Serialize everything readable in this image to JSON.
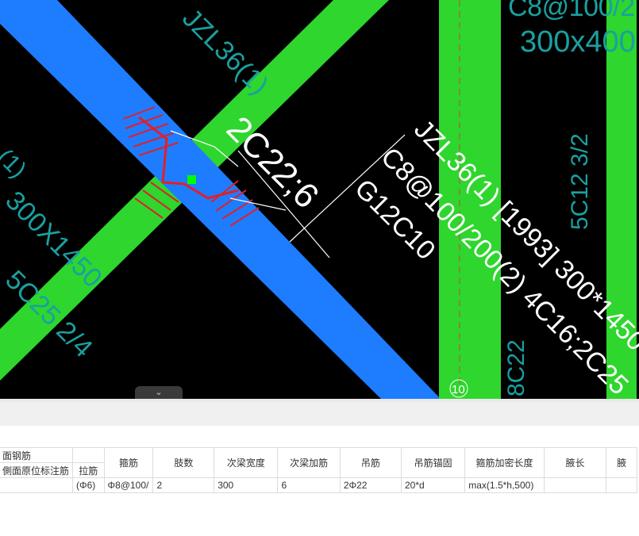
{
  "cad": {
    "upper_right_partial_label": "C8@100/2",
    "upper_right_dim": "300x400",
    "vertical_rebar": "5C12 3/2",
    "diag_beam_label": "JZL36(1)",
    "left_dim": "300X1450",
    "left_code": "5C25 2/4",
    "left_partial": "(1)",
    "hanger_text": "2C22;6",
    "annotation_line1": "JZL36(1) [1993] 300*1450",
    "annotation_line2": "C8@100/200(2) 4C16;2C25",
    "annotation_line3": "G12C10",
    "bottom_partial": "8C22",
    "axis_number": "10",
    "collapse_glyph": "⌄",
    "colors": {
      "blue_beam": "#1e7cff",
      "green_beam": "#2ed62e",
      "cyan_text": "#1aa0a0",
      "magenta_text": "#e040e0"
    }
  },
  "table": {
    "group_header_1": "面钢筋",
    "group_header_2": "側面原位标注筋",
    "col_lajin": "拉筋",
    "columns": [
      "箍筋",
      "肢数",
      "次梁宽度",
      "次梁加筋",
      "吊筋",
      "吊筋锚固",
      "箍筋加密长度",
      "腋长",
      "腋"
    ],
    "row": {
      "lajin": "(Φ6)",
      "values": [
        "Φ8@100/",
        "2",
        "300",
        "6",
        "2Φ22",
        "20*d",
        "max(1.5*h,500)",
        "",
        ""
      ]
    }
  }
}
